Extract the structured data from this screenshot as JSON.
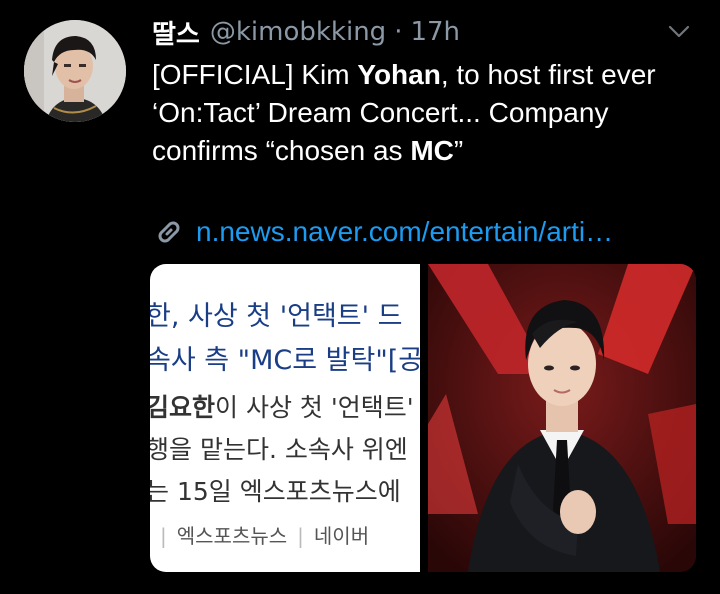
{
  "tweet": {
    "display_name": "딸스",
    "handle": "@kimobkking",
    "separator": "·",
    "time": "17h",
    "text": {
      "l1_pre": "[OFFICIAL] Kim ",
      "l1_bold": "Yohan",
      "l1_post": ", to host first ever",
      "l2": "‘On:Tact’ Dream Concert... Company",
      "l3_pre": "confirms “chosen as ",
      "l3_bold": "MC",
      "l3_post": "”"
    },
    "link": "n.news.naver.com/entertain/arti…"
  },
  "icons": {
    "more": "chevron-down-icon",
    "link": "link-icon"
  },
  "media": {
    "headline_1": "한, 사상 첫 '언택트' 드",
    "headline_2": "속사 측 \"MC로 발탁\"[공",
    "article_1_bold": "김요한",
    "article_1_rest": "이 사상 첫 '언택트'",
    "article_2": "행을 맡는다. 소속사 위엔",
    "article_3": "는 15일 엑스포츠뉴스에",
    "source_1": "엑스포츠뉴스",
    "source_2": "네이버"
  },
  "colors": {
    "background": "#000000",
    "link": "#1d9bf0",
    "secondary_text": "#8b98a5",
    "headline_blue": "#1a3e86"
  }
}
